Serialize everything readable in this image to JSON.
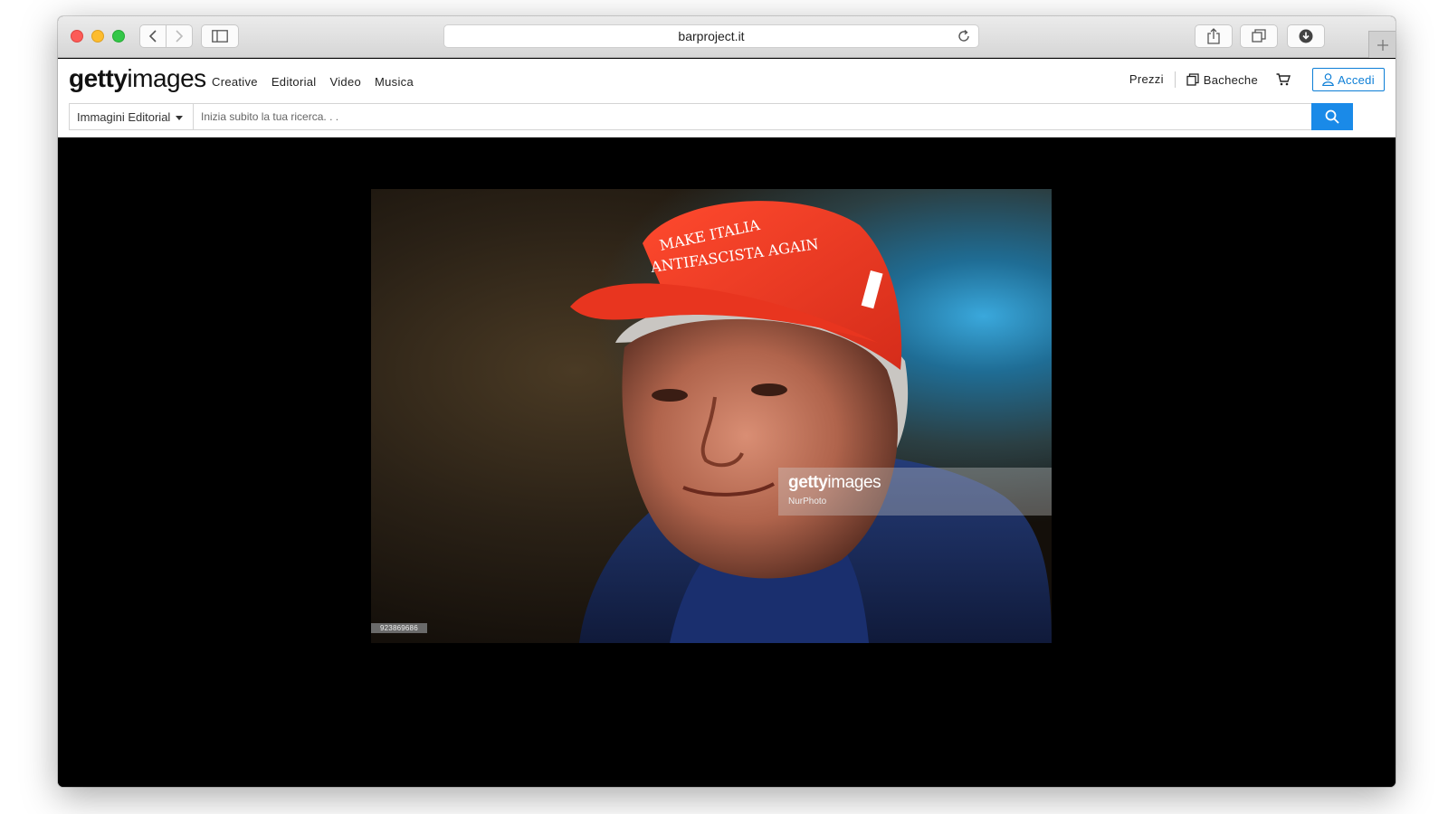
{
  "browser": {
    "url": "barproject.it"
  },
  "header": {
    "logo_bold": "getty",
    "logo_light": "images",
    "nav": [
      "Creative",
      "Editorial",
      "Video",
      "Musica"
    ],
    "prezzi": "Prezzi",
    "bacheche": "Bacheche",
    "accedi": "Accedi"
  },
  "search": {
    "filter": "Immagini Editorial",
    "placeholder": "Inizia subito la tua ricerca. . ."
  },
  "image": {
    "cap_text_line1": "MAKE ITALIA",
    "cap_text_line2": "ANTIFASCISTA AGAIN",
    "watermark_bold": "getty",
    "watermark_light": "images",
    "credit": "NurPhoto",
    "id": "923869686"
  },
  "colors": {
    "accent": "#1a8ae8",
    "cap": "#ee3b24"
  }
}
